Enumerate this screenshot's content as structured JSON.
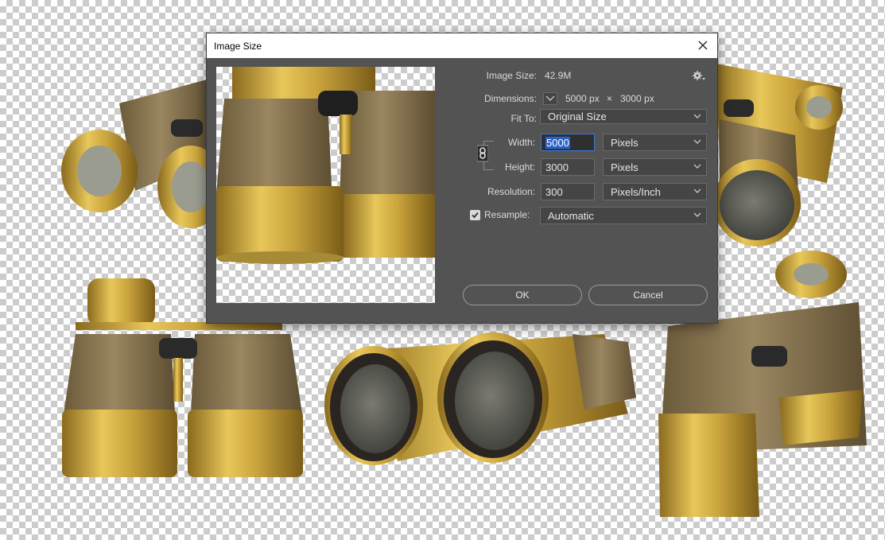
{
  "dialog": {
    "title": "Image Size",
    "image_size_label": "Image Size:",
    "image_size_value": "42.9M",
    "dimensions_label": "Dimensions:",
    "dim_width": "5000 px",
    "dim_x": "×",
    "dim_height": "3000 px",
    "fit_to_label": "Fit To:",
    "fit_to_value": "Original Size",
    "width_label": "Width:",
    "width_value": "5000",
    "width_unit": "Pixels",
    "height_label": "Height:",
    "height_value": "3000",
    "height_unit": "Pixels",
    "resolution_label": "Resolution:",
    "resolution_value": "300",
    "resolution_unit": "Pixels/Inch",
    "resample_label": "Resample:",
    "resample_checked": true,
    "resample_value": "Automatic",
    "ok_label": "OK",
    "cancel_label": "Cancel"
  },
  "icons": {
    "close": "close-icon",
    "gear": "gear-icon",
    "chevron": "chevron-down-icon",
    "link": "chain-link-icon",
    "check": "checkmark-icon"
  },
  "colors": {
    "dialog_bg": "#535353",
    "field_bg": "#454545",
    "text": "#dadada",
    "accent": "#2a62c9",
    "brass": "#c9a43f"
  }
}
